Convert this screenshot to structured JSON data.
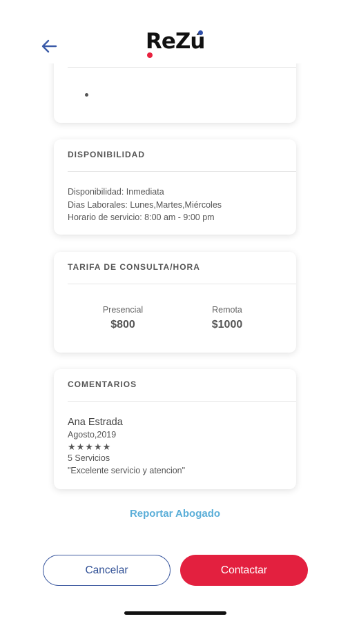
{
  "app": {
    "logo_text": "ReZú"
  },
  "colors": {
    "brand_red": "#e3203f",
    "brand_blue": "#2f4fa8",
    "link_blue": "#5aaed8"
  },
  "icons": {
    "back": "arrow-left-icon",
    "status": "status-indicator-icon"
  },
  "availability": {
    "title": "DISPONIBILIDAD",
    "lines": [
      "Disponibilidad: Inmediata",
      "Dias Laborales: Lunes,Martes,Miércoles",
      "Horario de servicio: 8:00 am - 9:00 pm"
    ]
  },
  "rates": {
    "title": "TARIFA DE CONSULTA/HORA",
    "items": [
      {
        "label": "Presencial",
        "value": "$800"
      },
      {
        "label": "Remota",
        "value": "$1000"
      }
    ]
  },
  "comments": {
    "title": "COMENTARIOS",
    "items": [
      {
        "name": "Ana Estrada",
        "date": "Agosto,2019",
        "stars": "★★★★★",
        "rating": 5,
        "services": "5 Servicios",
        "text": "\"Excelente servicio y atencion\""
      }
    ]
  },
  "actions": {
    "report": "Reportar Abogado",
    "cancel": "Cancelar",
    "contact": "Contactar"
  }
}
